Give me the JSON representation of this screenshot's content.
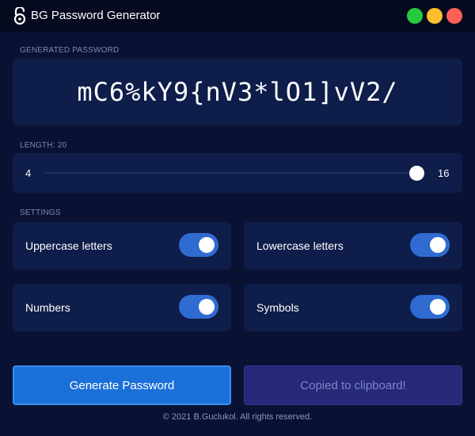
{
  "window": {
    "title": "BG Password Generator",
    "icon": "lock-open-icon",
    "controls": [
      {
        "name": "maximize",
        "color": "#27c93f"
      },
      {
        "name": "minimize",
        "color": "#ffbd2e"
      },
      {
        "name": "close",
        "color": "#ff5f57"
      }
    ]
  },
  "password": {
    "label": "GENERATED PASSWORD",
    "value": "mC6%kY9{nV3*lO1]vV2/"
  },
  "length": {
    "label": "LENGTH: 20",
    "min_label": "4",
    "max_label": "16",
    "value": 20
  },
  "settings": {
    "label": "SETTINGS",
    "options": [
      {
        "label": "Uppercase letters",
        "enabled": true
      },
      {
        "label": "Lowercase letters",
        "enabled": true
      },
      {
        "label": "Numbers",
        "enabled": true
      },
      {
        "label": "Symbols",
        "enabled": true
      }
    ]
  },
  "buttons": {
    "generate": "Generate Password",
    "copied": "Copied to clipboard!"
  },
  "footer": "© 2021 B.Guclukol. All rights reserved."
}
